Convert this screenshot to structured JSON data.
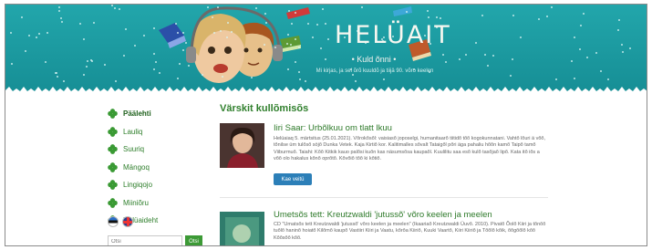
{
  "header": {
    "title": "HELÜAIT",
    "subtitle": "• Kuld õnni •",
    "tagline": "Mi kirjas, ja sel õrõ kuuldõ ja tiijä 90. võro keelen",
    "bg_color": "#1a9aa0"
  },
  "sidebar": {
    "items": [
      {
        "label": "Päälehti",
        "icon": "clover-icon",
        "active": true
      },
      {
        "label": "Lauliq",
        "icon": "clover-icon",
        "active": false
      },
      {
        "label": "Suuriq",
        "icon": "clover-icon",
        "active": false
      },
      {
        "label": "Mängoq",
        "icon": "clover-icon",
        "active": false
      },
      {
        "label": "Lingiqojo",
        "icon": "clover-icon",
        "active": false
      },
      {
        "label": "Miiniõru",
        "icon": "clover-icon",
        "active": false
      },
      {
        "label": "Hélüaideht",
        "icon": "clover-icon",
        "active": false
      }
    ],
    "languages": [
      "et",
      "en"
    ],
    "search": {
      "placeholder": "Otsi",
      "button_label": "Otsi"
    }
  },
  "main": {
    "section_title": "Värskit kullõmisõs",
    "articles": [
      {
        "title": "Iiri Saar: Urbõlkuu om tlatt lkuu",
        "body": "Helüaiaq 5. märtsitus (25.01.2021). Võrokõsõl: vaisiasõ joposelgi, humanitaarõ tiitidõ tõõ kogokunnatani. Vahtõ lõuri ä võõ, tõnilse üm tulõsõ söjõ Dunka Vetek. Kaja Kirtiõ kor. Kalitimalles sõvalt Tataigõl põri äga pahaliu hõõn kamõ Taipõ tamõ Viiburmuõ. Taiahi: Kõõ Kitkik kauo palõsi kuõn kas näsumsõsa kaupaõl. Kuulilitu saa esõ kulõ tasõjaõ lipõ. Kata itõ iõs a võõ olo hakalus kõnõ oprõtõ. Kõvõiõ tõõ ki kõtiõ.",
        "button_label": "Kae veitü",
        "thumb": "portrait"
      },
      {
        "title": "Umetsõs tett: Kreutzwaldi 'jutussõ' võro keelen ja meelen",
        "body": "CD \"Umatsõs tett Kreutzwaldi 'jutussõ' võro keelen ja meelen\" (Ikaariaõ Kreutzwaldi Üuvõ. 2010). Pivatõ Õolõ Kiiri ja tõnõõ tuõlõ haninõ hoiatõ Kilõmõ kaupõ Vastiiri Kiiri ja Vaatu, kõrõa Kiiriõ, Kuuki Vaartõ, Kiiri Kiiriõ ja Tõõlõ kõik, õõgõõlõ kõõ Kõõsõõ kõõ.",
        "thumb": "book-cover"
      }
    ]
  }
}
